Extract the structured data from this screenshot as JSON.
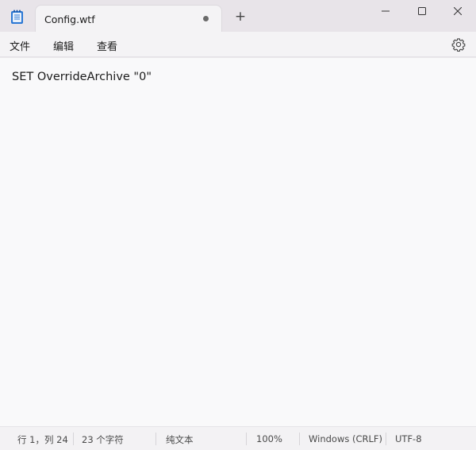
{
  "tab": {
    "title": "Config.wtf"
  },
  "new_tab_label": "+",
  "menu": {
    "file": "文件",
    "edit": "编辑",
    "view": "查看"
  },
  "editor": {
    "content": "SET OverrideArchive \"0\""
  },
  "status": {
    "position": "行 1，列 24",
    "char_count": "23 个字符",
    "format": "纯文本",
    "zoom": "100%",
    "line_ending": "Windows (CRLF)",
    "encoding": "UTF-8"
  },
  "icons": {
    "app": "notepad-icon",
    "unsaved": "unsaved-dot-icon",
    "settings": "gear-icon",
    "minimize": "minimize-icon",
    "maximize": "maximize-icon",
    "close": "close-icon"
  },
  "colors": {
    "titlebar": "#e8e4e9",
    "tab": "#f4f3f5",
    "editor": "#f9f9fa"
  }
}
